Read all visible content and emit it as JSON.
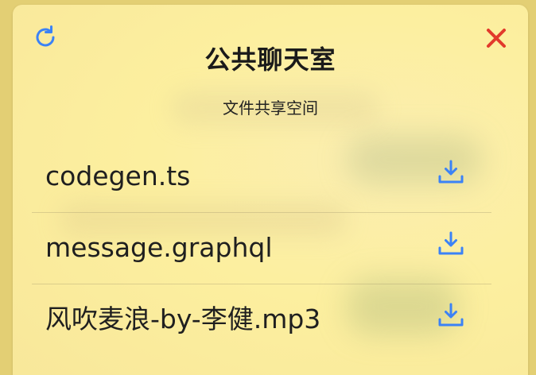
{
  "header": {
    "title": "公共聊天室",
    "subtitle": "文件共享空间",
    "refresh_icon": "refresh-icon",
    "close_icon": "close-icon"
  },
  "files": [
    {
      "name": "codegen.ts",
      "action_icon": "download-icon"
    },
    {
      "name": "message.graphql",
      "action_icon": "download-icon"
    },
    {
      "name": "风吹麦浪-by-李健.mp3",
      "action_icon": "download-icon"
    }
  ],
  "colors": {
    "accent": "#3b82f6",
    "close": "#e23a2c",
    "panel_bg": "#fcef9f",
    "text": "#1f1f1f"
  }
}
